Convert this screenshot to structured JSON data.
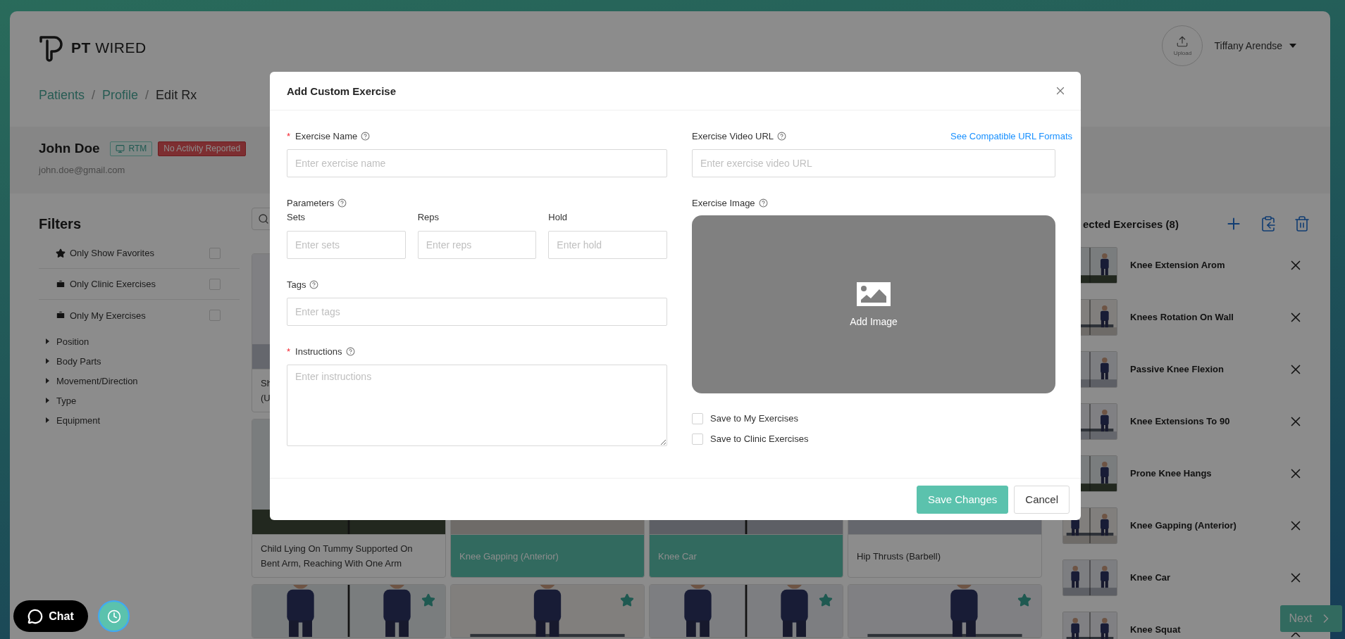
{
  "header": {
    "logo": "**PT** WIRED",
    "upload_label": "Upload",
    "user_name": "Tiffany Arendse"
  },
  "breadcrumb": {
    "items": [
      {
        "label": "Patients",
        "current": false
      },
      {
        "label": "Profile",
        "current": false
      },
      {
        "label": "Edit Rx",
        "current": true
      }
    ],
    "separators": [
      "/",
      "/"
    ]
  },
  "patient": {
    "name": "John Doe",
    "badges": [
      {
        "label": "RTM",
        "kind": "program"
      },
      {
        "label": "No Activity Reported",
        "kind": "alert"
      }
    ],
    "email": "john.doe@gmail.com"
  },
  "filters": {
    "title": "Filters",
    "toggles": [
      {
        "kind": "favorites",
        "label": "Only Show Favorites",
        "checked": false
      },
      {
        "kind": "clinic",
        "label": "Only Clinic Exercises",
        "checked": false
      },
      {
        "kind": "mine",
        "label": "Only My Exercises",
        "checked": false
      }
    ],
    "categories": [
      {
        "label": "Position",
        "expanded": false
      },
      {
        "label": "Body Parts",
        "expanded": false
      },
      {
        "label": "Movement/Direction",
        "expanded": false
      },
      {
        "label": "Type",
        "expanded": false
      },
      {
        "label": "Equipment",
        "expanded": false
      }
    ]
  },
  "exercise_grid": {
    "rows": [
      [
        {
          "title_lines": [
            "Sh",
            "(U"
          ],
          "selected": false
        }
      ],
      [
        {
          "title_lines": [
            "Child Lying On Tummy Supported On",
            "Bent Arm, Reaching With One Arm"
          ],
          "selected": false
        },
        {
          "title_lines": [
            "Knee Gapping (Anterior)"
          ],
          "selected": true
        },
        {
          "title_lines": [
            "Knee Car"
          ],
          "selected": true
        },
        {
          "title_lines": [
            "Hip Thrusts (Barbell)"
          ],
          "selected": false
        }
      ],
      [
        {
          "favorite": true
        },
        {
          "favorite": true
        },
        {
          "favorite": true
        },
        {
          "favorite": true
        }
      ]
    ]
  },
  "selected_exercises": {
    "heading": "ected Exercises (8)",
    "items": [
      "Knee Extension Arom",
      "Knees Rotation On Wall",
      "Passive Knee Flexion",
      "Knee Extensions To 90",
      "Prone Knee Hangs",
      "Knee Gapping (Anterior)",
      "Knee Car",
      "Knee Squat"
    ]
  },
  "modal": {
    "title": "Add Custom Exercise",
    "exercise_name": {
      "label": "Exercise Name",
      "required_mark": "*",
      "placeholder": "Enter exercise name"
    },
    "parameters": {
      "label": "Parameters",
      "fields": [
        {
          "label": "Sets",
          "placeholder": "Enter sets"
        },
        {
          "label": "Reps",
          "placeholder": "Enter reps"
        },
        {
          "label": "Hold",
          "placeholder": "Enter hold"
        }
      ]
    },
    "tags": {
      "label": "Tags",
      "placeholder": "Enter tags"
    },
    "instructions": {
      "label": "Instructions",
      "required_mark": "*",
      "placeholder": "Enter instructions"
    },
    "video_url": {
      "label": "Exercise Video URL",
      "placeholder": "Enter exercise video URL",
      "link": "See Compatible URL Formats"
    },
    "image": {
      "label": "Exercise Image",
      "action": "Add Image"
    },
    "save_options": [
      {
        "label": "Save to My Exercises",
        "checked": false
      },
      {
        "label": "Save to Clinic Exercises",
        "checked": false
      }
    ],
    "buttons": [
      {
        "label": "Save Changes",
        "kind": "primary"
      },
      {
        "label": "Cancel",
        "kind": "default"
      }
    ]
  },
  "chat": {
    "label": "Chat"
  },
  "next_button": {
    "label": "Next"
  }
}
